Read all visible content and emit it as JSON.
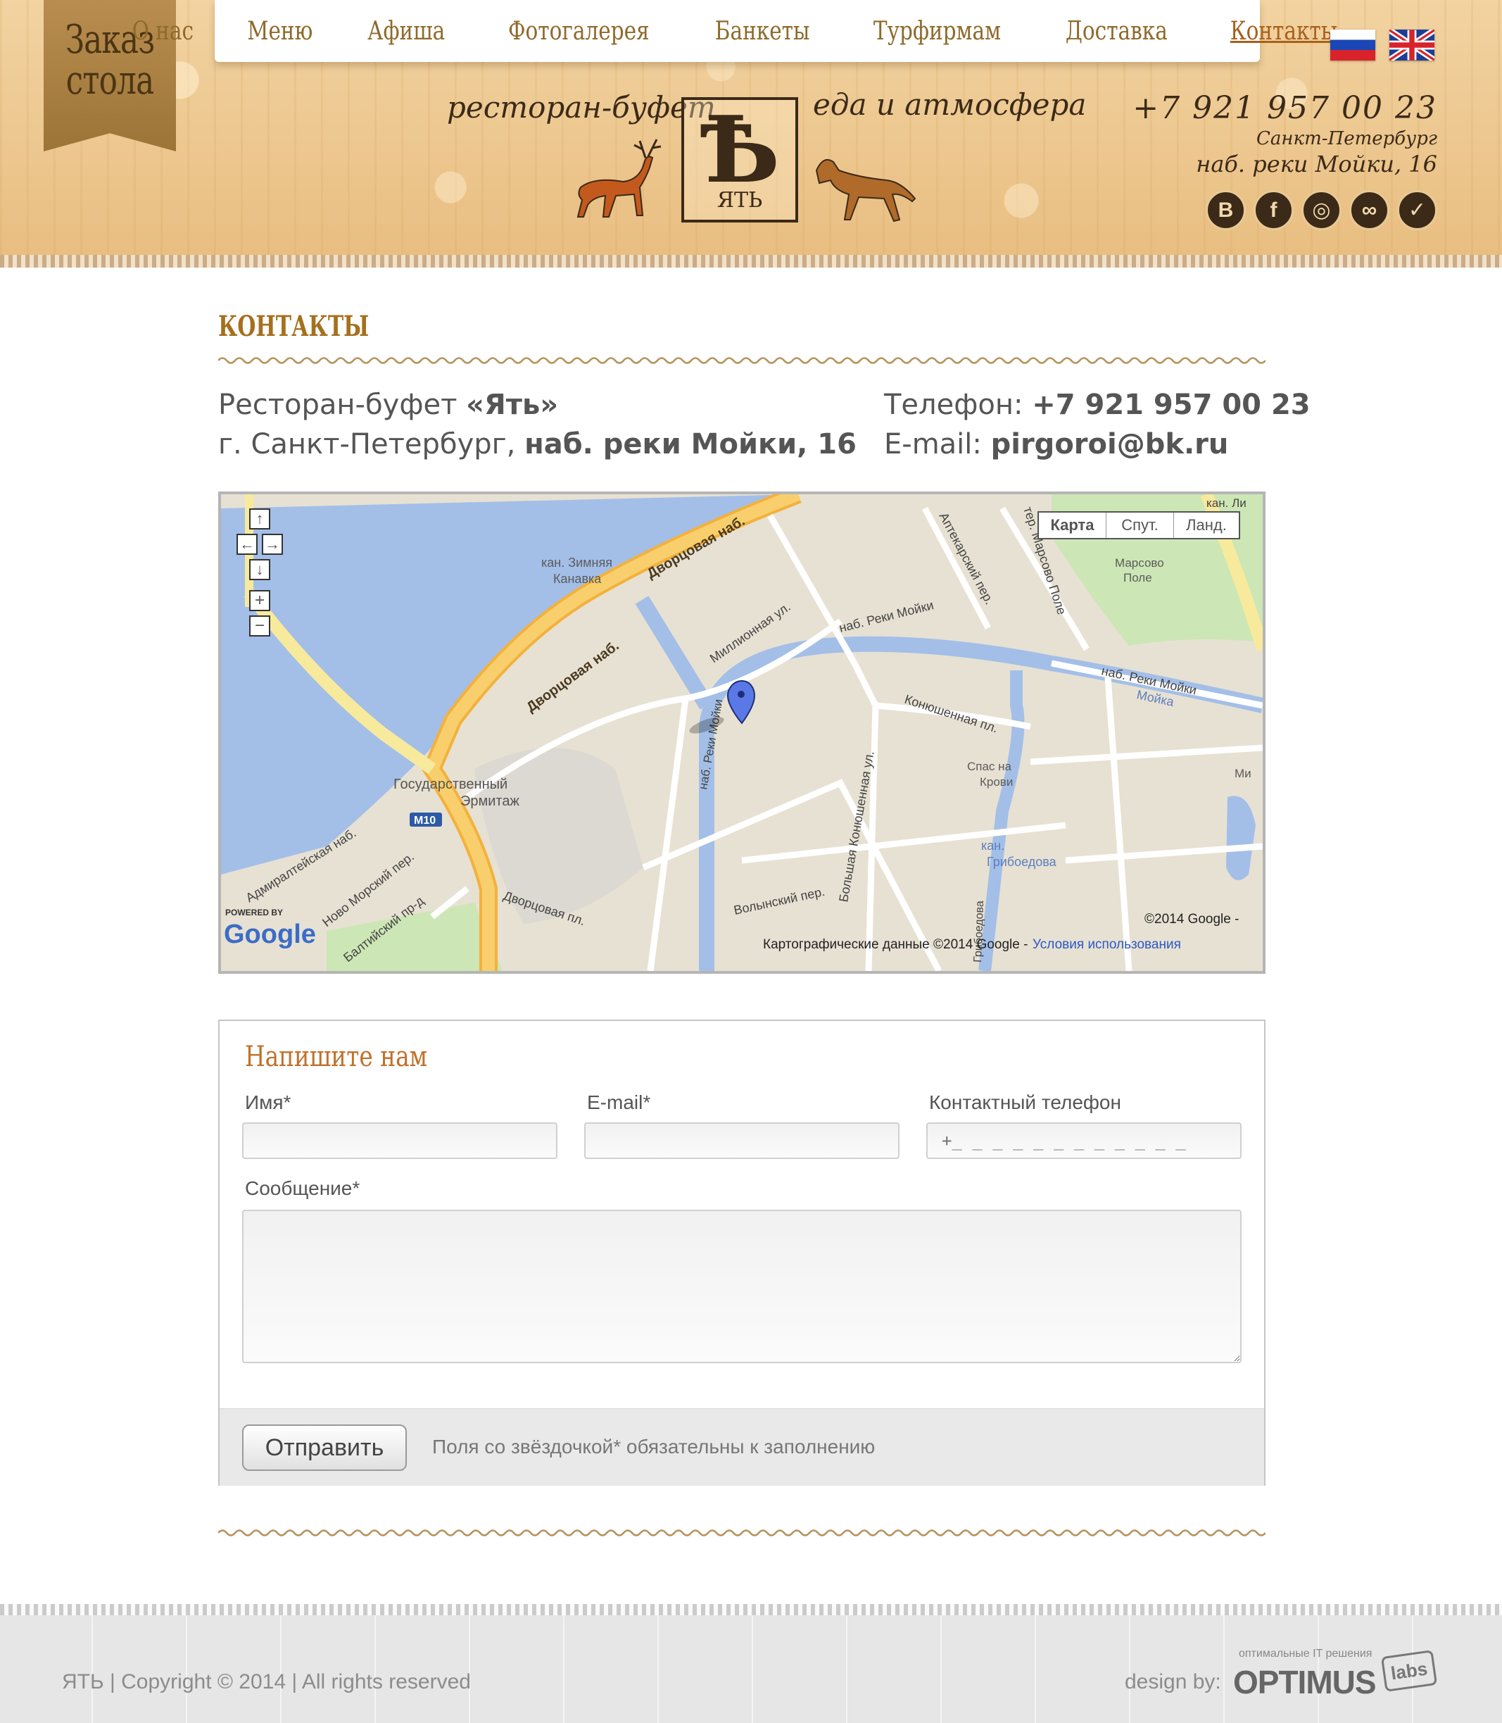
{
  "header": {
    "order_button": "Заказ стола",
    "nav": [
      {
        "label": "О нас",
        "active": false
      },
      {
        "label": "Меню",
        "active": false
      },
      {
        "label": "Афиша",
        "active": false
      },
      {
        "label": "Фотогалерея",
        "active": false
      },
      {
        "label": "Банкеты",
        "active": false
      },
      {
        "label": "Турфирмам",
        "active": false
      },
      {
        "label": "Доставка",
        "active": false
      },
      {
        "label": "Контакты",
        "active": true
      }
    ],
    "tagline_left": "ресторан-буфет",
    "tagline_right": "еда и атмосфера",
    "logo_letter": "Ѣ",
    "logo_name": "ЯТЬ",
    "phone": "+7 921 957 00 23",
    "city": "Санкт-Петербург",
    "address": "наб. реки Мойки, 16",
    "languages": [
      "ru-flag-icon",
      "uk-flag-icon"
    ],
    "social": [
      {
        "icon": "vk-icon",
        "glyph": "В"
      },
      {
        "icon": "facebook-icon",
        "glyph": "f"
      },
      {
        "icon": "instagram-icon",
        "glyph": "◎"
      },
      {
        "icon": "tripadvisor-icon",
        "glyph": "∞"
      },
      {
        "icon": "foursquare-icon",
        "glyph": "✓"
      }
    ]
  },
  "contacts": {
    "title": "КОНТАКТЫ",
    "restaurant_prefix": "Ресторан-буфет ",
    "restaurant_name": "«Ять»",
    "city_prefix": "г. Санкт-Петербург, ",
    "address": "наб. реки Мойки, 16",
    "phone_label": "Телефон: ",
    "phone": "+7 921 957 00 23",
    "email_label": "E-mail: ",
    "email": "pirgoroi@bk.ru"
  },
  "map": {
    "type_buttons": [
      "Карта",
      "Спут.",
      "Ланд."
    ],
    "labels": {
      "dvortsovaya1": "Дворцовая наб.",
      "dvortsovaya2": "Дворцовая наб.",
      "kanavka1": "кан. Зимняя",
      "kanavka2": "Канавка",
      "millionnaya": "Миллионная ул.",
      "moika1": "наб. Реки Мойки",
      "moika2": "наб. Реки Мойки",
      "moika_river": "Мойка",
      "konyushennaya": "Конюшенная пл.",
      "aptekarsky": "Аптекарский пер.",
      "marsovo_ter": "тер. Марсово Поле",
      "marsovo1": "Марсово",
      "marsovo2": "Поле",
      "hermitage1": "Государственный",
      "hermitage2": "Эрмитаж",
      "spas1": "Спас на",
      "spas2": "Крови",
      "griboedova1": "кан.",
      "griboedova2": "Грибоедова",
      "bolshaya": "Большая Конюшенная ул.",
      "volynsky": "Волынский пер.",
      "dvortsovaya_pl": "Дворцовая пл.",
      "admiralteyskaya": "Адмиралтейская наб.",
      "novomorsky": "Ново Морский пер.",
      "baltiysky": "Балтийский пр-д",
      "m10": "M10",
      "moika_nab": "наб. Реки Мойки",
      "griboedova_v": "Грибоедова",
      "kan_top": "кан. Ли",
      "mi": "Ми"
    },
    "powered_by": "POWERED BY",
    "google": "Google",
    "copyright": "©2014 Google -",
    "data_notice": "Картографические данные ©2014 Google -",
    "terms_link": "Условия использования"
  },
  "form": {
    "title": "Напишите нам",
    "name_label": "Имя*",
    "email_label": "E-mail*",
    "phone_label": "Контактный телефон",
    "phone_placeholder": "+_ _ _ _ _ _ _ _ _ _ _ _",
    "message_label": "Сообщение*",
    "submit": "Отправить",
    "required_note": "Поля со звёздочкой* обязательны к заполнению"
  },
  "footer": {
    "copyright": "ЯТЬ  |  Copyright  ©  2014  |  All rights reserved",
    "design_by": "design by:",
    "company_tagline": "оптимальные IT решения",
    "company": "OPTIMUS",
    "labs": "labs"
  },
  "colors": {
    "accent_brown": "#a5701e",
    "nav_text": "#8e6a2a",
    "header_bg": "#ecc892",
    "form_title": "#c0712b",
    "map_water": "#a3bfe8",
    "map_road_orange": "#f3b13c"
  }
}
